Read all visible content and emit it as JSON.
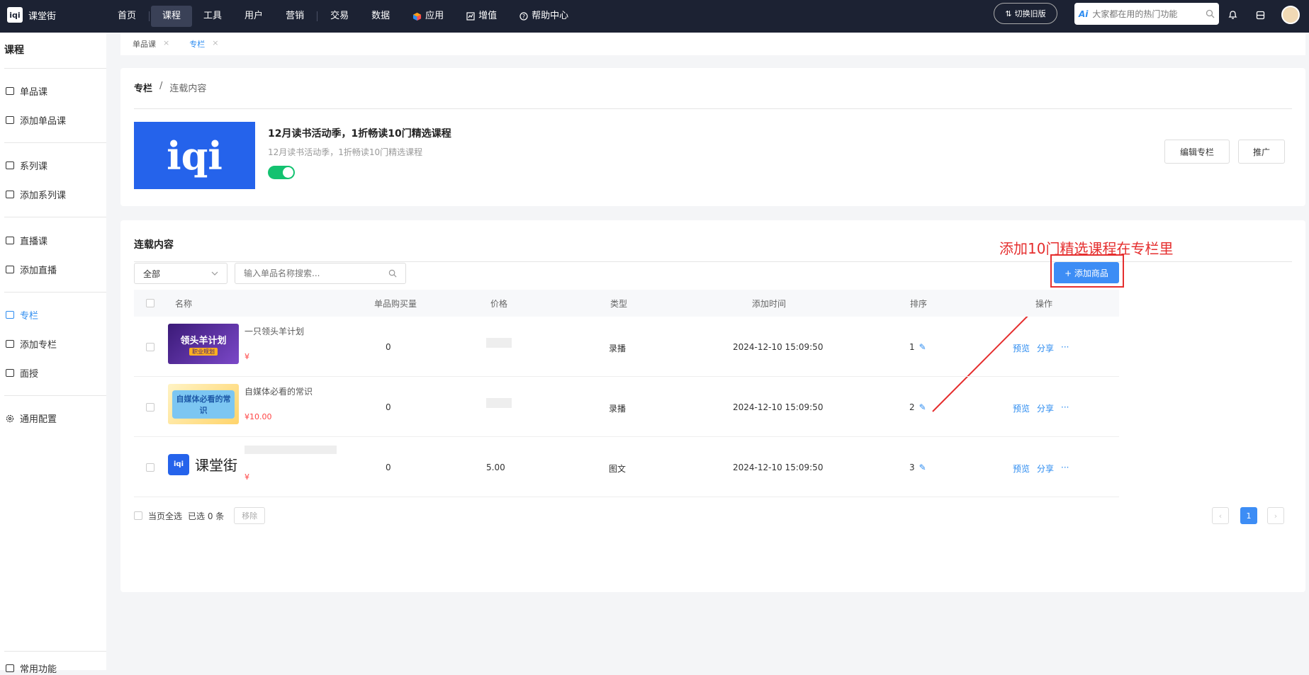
{
  "topbar": {
    "brand": "课堂街",
    "logo_glyph": "iqi",
    "nav": [
      {
        "label": "首页",
        "icon": ""
      },
      {
        "label": "课程",
        "icon": ""
      },
      {
        "label": "工具",
        "icon": ""
      },
      {
        "label": "用户",
        "icon": ""
      },
      {
        "label": "营销",
        "icon": ""
      },
      {
        "label": "交易",
        "icon": ""
      },
      {
        "label": "数据",
        "icon": ""
      },
      {
        "label": "应用",
        "icon": "cube-icon"
      },
      {
        "label": "增值",
        "icon": "chart-icon"
      },
      {
        "label": "帮助中心",
        "icon": "help-icon"
      }
    ],
    "active_nav": "课程",
    "switch_label": "切换旧版",
    "search_badge": "Ai",
    "search_placeholder": "大家都在用的热门功能"
  },
  "sidebar": {
    "title": "课程",
    "items": [
      {
        "label": "单品课",
        "icon": "doc-icon"
      },
      {
        "label": "添加单品课",
        "icon": "add-doc-icon"
      },
      {
        "label": "系列课",
        "icon": "stack-icon"
      },
      {
        "label": "添加系列课",
        "icon": "add-stack-icon"
      },
      {
        "label": "直播课",
        "icon": "video-icon"
      },
      {
        "label": "添加直播",
        "icon": "add-video-icon"
      },
      {
        "label": "专栏",
        "icon": "column-icon"
      },
      {
        "label": "添加专栏",
        "icon": "add-column-icon"
      },
      {
        "label": "面授",
        "icon": "classroom-icon"
      },
      {
        "label": "通用配置",
        "icon": "gear-icon"
      }
    ],
    "active": "专栏",
    "bottom_label": "常用功能"
  },
  "tabs": [
    {
      "label": "单品课",
      "close": "×"
    },
    {
      "label": "专栏",
      "close": "×"
    }
  ],
  "column": {
    "crumb_root": "专栏",
    "crumb_sep": "/",
    "crumb_current": "连载内容",
    "thumb_glyph": "iqi",
    "title": "12月读书活动季，1折畅读10门精选课程",
    "subtitle": "12月读书活动季，1折畅读10门精选课程",
    "enabled": true,
    "edit_label": "编辑专栏",
    "promote_label": "推广"
  },
  "serial": {
    "title": "连载内容",
    "annotation": "添加10门精选课程在专栏里",
    "filter_value": "全部",
    "search_placeholder": "输入单品名称搜索...",
    "add_label": "+ 添加商品",
    "headers": [
      "名称",
      "单品购买量",
      "价格",
      "类型",
      "添加时间",
      "排序",
      "操作"
    ],
    "rows": [
      {
        "name": "一只领头羊计划",
        "price_tag": "¥",
        "image_text": "领头羊计划",
        "image_sub": "职业规划",
        "purchases": "0",
        "price": "",
        "type": "录播",
        "time": "2024-12-10 15:09:50",
        "sort": "1",
        "op1": "预览",
        "op2": "分享",
        "more": "···"
      },
      {
        "name": "自媒体必看的常识",
        "price_tag": "¥10.00",
        "image_text": "自媒体必看的常识",
        "image_sub": "",
        "purchases": "0",
        "price": "",
        "type": "录播",
        "time": "2024-12-10 15:09:50",
        "sort": "2",
        "op1": "预览",
        "op2": "分享",
        "more": "···"
      },
      {
        "name": "",
        "price_tag": "¥",
        "image_text": "课堂街",
        "image_sub": "",
        "purchases": "0",
        "price": "5.00",
        "type": "图文",
        "time": "2024-12-10 15:09:50",
        "sort": "3",
        "op1": "预览",
        "op2": "分享",
        "more": "···"
      }
    ],
    "select_all": "当页全选",
    "selected": "已选 0 条",
    "remove_label": "移除",
    "pager_prev": "‹",
    "current_page": "1",
    "pager_next": "›"
  }
}
